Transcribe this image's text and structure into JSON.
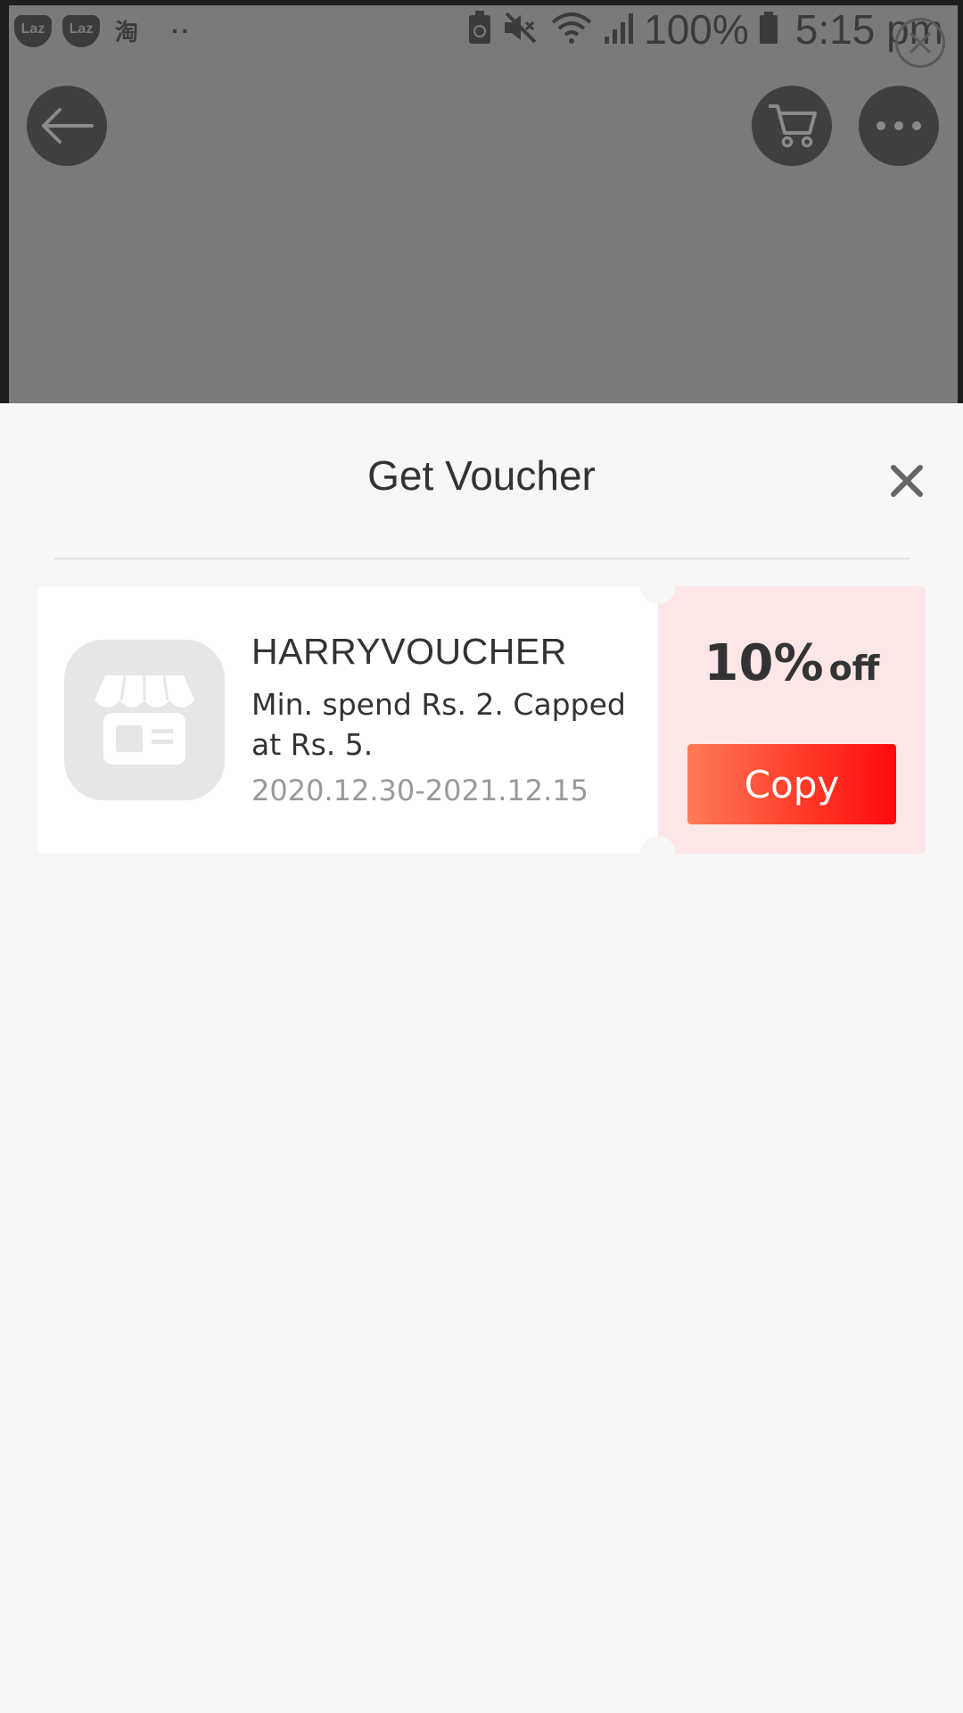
{
  "status_bar": {
    "notif_laz_1": "Laz",
    "notif_laz_2": "Laz",
    "notif_taobao": "淘",
    "battery_pct": "100%",
    "time": "5:15 pm"
  },
  "background_page": {
    "icons": [
      "back-arrow-icon",
      "cart-icon",
      "more-icon",
      "close-icon"
    ]
  },
  "sheet": {
    "title": "Get Voucher",
    "close_icon": "close-icon"
  },
  "voucher": {
    "code": "HARRYVOUCHER",
    "description": "Min. spend Rs. 2. Capped at Rs. 5.",
    "validity": "2020.12.30-2021.12.15",
    "discount_value": "10%",
    "discount_suffix": "off",
    "copy_label": "Copy",
    "icon": "shop-icon"
  },
  "colors": {
    "accent": "#ff0a0a",
    "accent_start": "#ff7b56",
    "voucher_right_bg": "#fde6e6"
  }
}
